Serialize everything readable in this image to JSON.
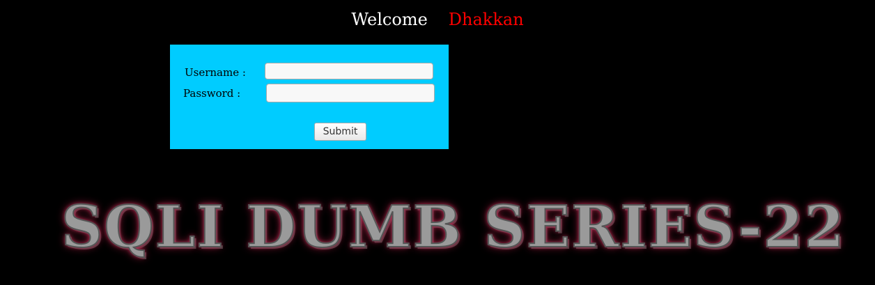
{
  "header": {
    "welcome": "Welcome",
    "name": "Dhakkan"
  },
  "form": {
    "username_label": "Username :",
    "password_label": "Password :",
    "username_value": "",
    "password_value": "",
    "submit_label": "Submit",
    "bg_color": "#00ccff"
  },
  "banner": {
    "text": "SQLI DUMB SERIES-22"
  }
}
